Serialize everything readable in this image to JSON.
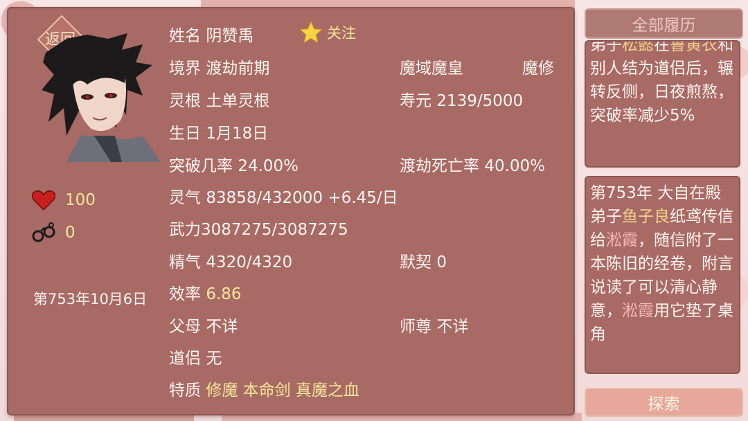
{
  "back_label": "返回",
  "profile": {
    "name_label": "姓名",
    "name": "阴赞禹",
    "follow_label": "关注",
    "realm_label": "境界",
    "realm": "渡劫前期",
    "title": "魔域魔皇",
    "cult_type": "魔修",
    "root_label": "灵根",
    "root": "土单灵根",
    "life_label": "寿元",
    "life": "2139/5000",
    "birth_label": "生日",
    "birth": "1月18日",
    "breakthrough_label": "突破几率",
    "breakthrough": "24.00%",
    "tribulation_label": "渡劫死亡率",
    "tribulation": "40.00%",
    "qi_label": "灵气",
    "qi": "83858/432000 +6.45/日",
    "force_label": "武力",
    "force": "3087275/3087275",
    "essence_label": "精气",
    "essence": "4320/4320",
    "tacit_label": "默契",
    "tacit": "0",
    "efficiency_label": "效率",
    "efficiency": "6.86",
    "parents_label": "父母",
    "parents": "不详",
    "master_label": "师尊",
    "master": "不详",
    "partner_label": "道侣",
    "partner": "无",
    "traits_label": "特质",
    "traits": [
      "修魔",
      "本命剑",
      "真魔之血"
    ]
  },
  "stats": {
    "hearts": "100",
    "cuffs": "0"
  },
  "date": "第753年10月6日",
  "history_button": "全部履历",
  "explore_button": "探索",
  "news1": {
    "p1": "弟子",
    "n1": "松懿",
    "p2": "在",
    "n2": "鲁黄衣",
    "p3": "和别人结为道侣后，辗转反侧，日夜煎熬，突破率减少5%"
  },
  "news2": {
    "p1": "第753年 大自在殿弟子",
    "n1": "鱼子良",
    "p2": "纸鸢传信给",
    "n2": "淞霞",
    "p3": "，随信附了一本陈旧的经卷，附言说读了可以清心静意，",
    "n3": "淞霞",
    "p4": "用它垫了桌角"
  },
  "colors": {
    "panel": "#a86a64",
    "highlight": "#f7e79a",
    "gold_name": "#f3d38a",
    "pink_name": "#f3b9b9"
  },
  "icons": [
    "star-icon",
    "heart-icon",
    "handcuffs-icon"
  ]
}
